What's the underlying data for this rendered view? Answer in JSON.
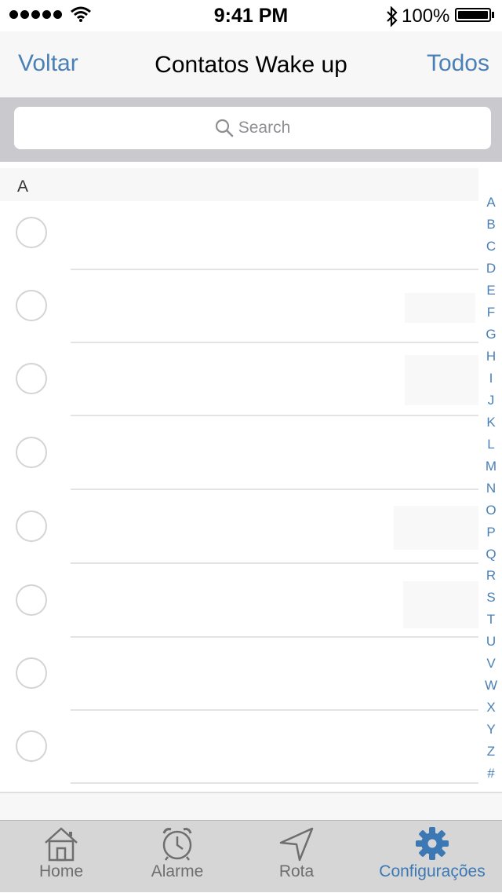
{
  "status_bar": {
    "time": "9:41 PM",
    "battery": "100%"
  },
  "nav": {
    "back_label": "Voltar",
    "title": "Contatos Wake up",
    "right_label": "Todos"
  },
  "search": {
    "placeholder": "Search"
  },
  "section": {
    "letter": "A"
  },
  "contacts_count_visible": 8,
  "index_letters": [
    "A",
    "B",
    "C",
    "D",
    "E",
    "F",
    "G",
    "H",
    "I",
    "J",
    "K",
    "L",
    "M",
    "N",
    "O",
    "P",
    "Q",
    "R",
    "S",
    "T",
    "U",
    "V",
    "W",
    "X",
    "Y",
    "Z",
    "#"
  ],
  "tabs": [
    {
      "label": "Home",
      "icon": "home-icon",
      "active": false
    },
    {
      "label": "Alarme",
      "icon": "alarm-clock-icon",
      "active": false
    },
    {
      "label": "Rota",
      "icon": "location-arrow-icon",
      "active": false
    },
    {
      "label": "Configurações",
      "icon": "gear-icon",
      "active": true
    }
  ],
  "colors": {
    "accent": "#4a80b6",
    "active_tab": "#3c78b4",
    "tab_bar": "#d6d6d6",
    "search_bg": "#c9c9ce"
  }
}
